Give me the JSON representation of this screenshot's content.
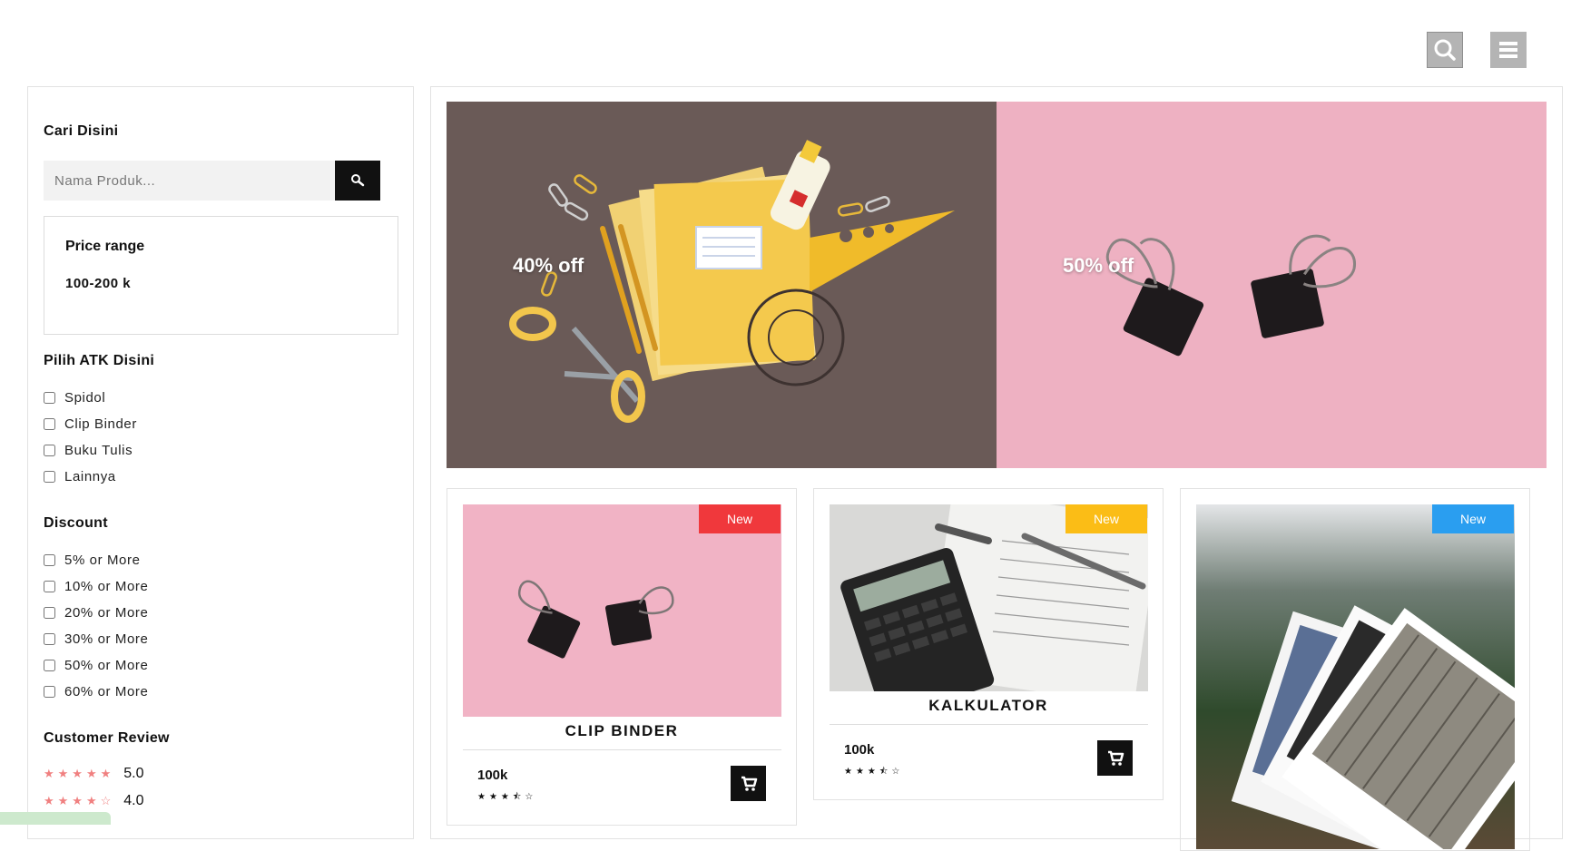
{
  "header": {
    "search_icon": "search-icon",
    "menu_icon": "hamburger-menu-icon"
  },
  "sidebar": {
    "search_title": "Cari Disini",
    "search_placeholder": "Nama Produk...",
    "price_title": "Price range",
    "price_value": "100-200 k",
    "atk_title": "Pilih ATK Disini",
    "atk_options": [
      "Spidol",
      "Clip Binder",
      "Buku Tulis",
      "Lainnya"
    ],
    "discount_title": "Discount",
    "discount_options": [
      "5% or More",
      "10% or More",
      "20% or More",
      "30% or More",
      "50% or More",
      "60% or More"
    ],
    "review_title": "Customer Review",
    "reviews": [
      {
        "stars": "★★★★★",
        "value": "5.0",
        "rating": 5
      },
      {
        "stars": "★★★★☆",
        "value": "4.0",
        "rating": 4
      }
    ]
  },
  "banners": [
    {
      "promo": "40% off"
    },
    {
      "promo": "50% off"
    }
  ],
  "products": [
    {
      "name": "CLIP BINDER",
      "badge": "New",
      "badge_color": "#f0383c",
      "price": "100k",
      "stars": "★★★⯪☆",
      "rating": 3.5
    },
    {
      "name": "KALKULATOR",
      "badge": "New",
      "badge_color": "#fbbd16",
      "price": "100k",
      "stars": "★★★⯪☆",
      "rating": 3.5
    },
    {
      "name": "",
      "badge": "New",
      "badge_color": "#2a9ef0",
      "price": "",
      "stars": "",
      "rating": null
    }
  ],
  "colors": {
    "accent_dark": "#111111",
    "star_color": "#f08080"
  }
}
